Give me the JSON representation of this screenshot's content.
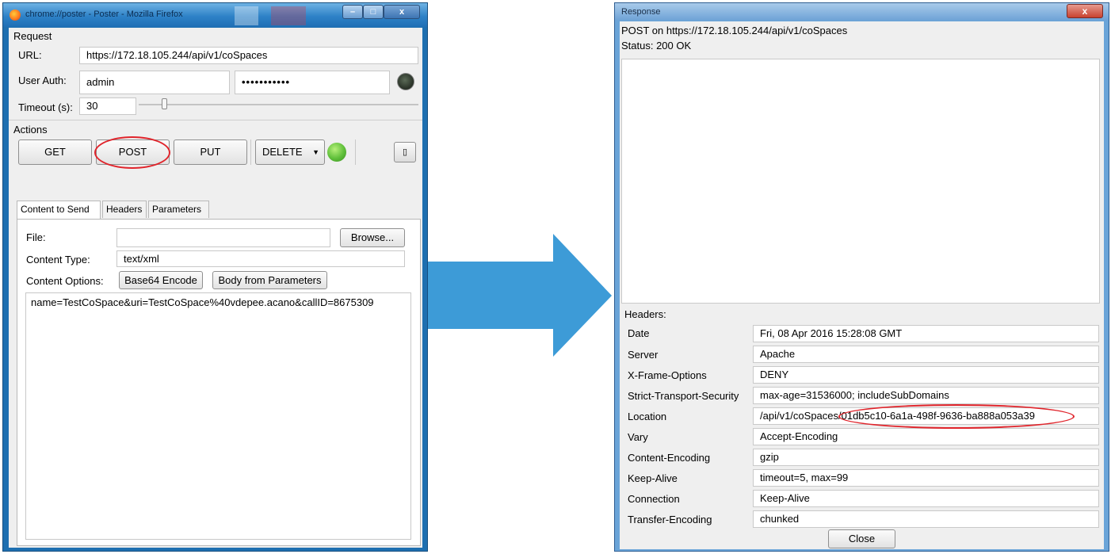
{
  "poster_window": {
    "title": "chrome://poster - Poster - Mozilla Firefox",
    "controls": {
      "minimize": "–",
      "maximize": "□",
      "close": "x"
    },
    "request": {
      "section_label": "Request",
      "url_label": "URL:",
      "url_value": "https://172.18.105.244/api/v1/coSpaces",
      "user_auth_label": "User Auth:",
      "username": "admin",
      "password_mask": "•••••••••••",
      "timeout_label": "Timeout (s):",
      "timeout_value": "30"
    },
    "actions": {
      "section_label": "Actions",
      "get": "GET",
      "post": "POST",
      "put": "PUT",
      "delete": "DELETE",
      "status_light_color": "#5fbf3a"
    },
    "tabs": [
      "Content to Send",
      "Headers",
      "Parameters"
    ],
    "active_tab": "Content to Send",
    "content": {
      "file_label": "File:",
      "file_value": "",
      "browse": "Browse...",
      "content_type_label": "Content Type:",
      "content_type_value": "text/xml",
      "content_options_label": "Content Options:",
      "base64_button": "Base64 Encode",
      "body_params_button": "Body from Parameters",
      "body": "name=TestCoSpace&uri=TestCoSpace%40vdepee.acano&callID=8675309"
    }
  },
  "arrow_color": "#3d9bd7",
  "highlight_color": "#e0242b",
  "response_window": {
    "title": "Response",
    "close_icon": "x",
    "summary": "POST on https://172.18.105.244/api/v1/coSpaces",
    "status": "Status:  200 OK",
    "headers_label": "Headers:",
    "headers": [
      {
        "name": "Date",
        "value": "Fri, 08 Apr 2016 15:28:08 GMT"
      },
      {
        "name": "Server",
        "value": "Apache"
      },
      {
        "name": "X-Frame-Options",
        "value": "DENY"
      },
      {
        "name": "Strict-Transport-Security",
        "value": "max-age=31536000; includeSubDomains"
      },
      {
        "name": "Location",
        "value": "/api/v1/coSpaces/01db5c10-6a1a-498f-9636-ba888a053a39"
      },
      {
        "name": "Vary",
        "value": "Accept-Encoding"
      },
      {
        "name": "Content-Encoding",
        "value": "gzip"
      },
      {
        "name": "Keep-Alive",
        "value": "timeout=5, max=99"
      },
      {
        "name": "Connection",
        "value": "Keep-Alive"
      },
      {
        "name": "Transfer-Encoding",
        "value": "chunked"
      }
    ],
    "close_button": "Close"
  }
}
